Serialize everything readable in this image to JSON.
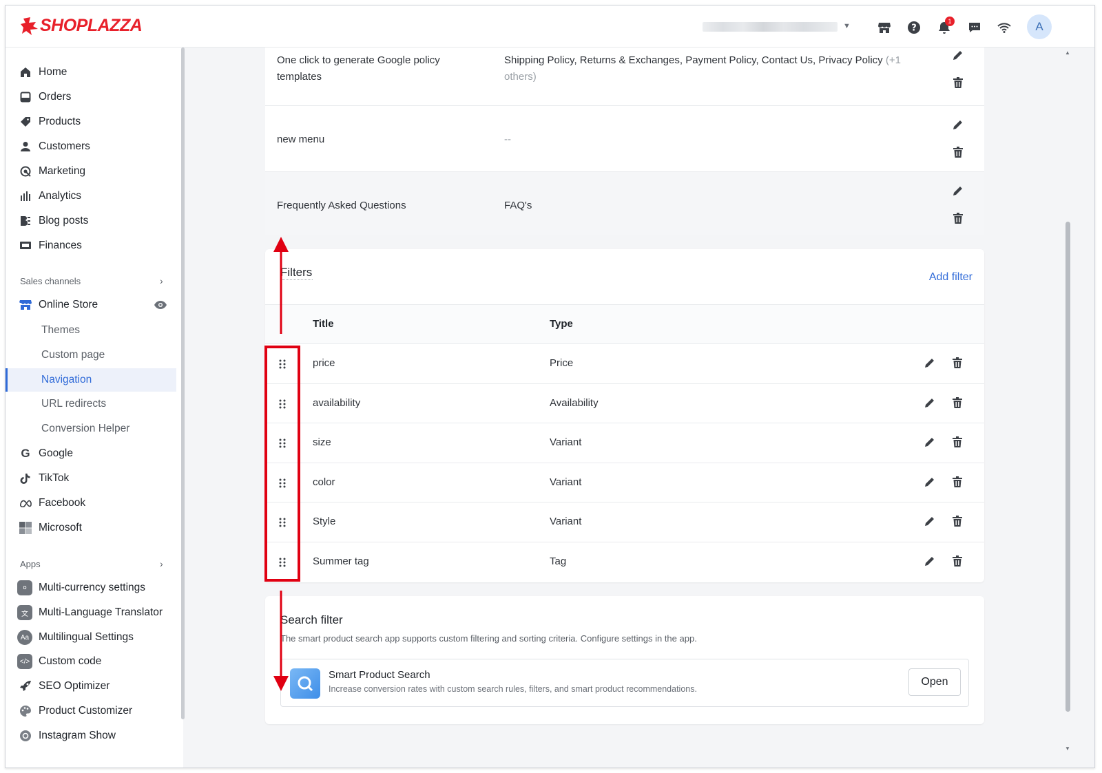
{
  "header": {
    "logo_text": "SHOPLAZZA",
    "notification_count": "1",
    "avatar_initial": "A"
  },
  "sidebar": {
    "main_items": [
      {
        "label": "Home",
        "icon": "home-icon"
      },
      {
        "label": "Orders",
        "icon": "orders-icon"
      },
      {
        "label": "Products",
        "icon": "tag-icon"
      },
      {
        "label": "Customers",
        "icon": "person-icon"
      },
      {
        "label": "Marketing",
        "icon": "marketing-icon"
      },
      {
        "label": "Analytics",
        "icon": "bar-chart-icon"
      },
      {
        "label": "Blog posts",
        "icon": "blog-icon"
      },
      {
        "label": "Finances",
        "icon": "finances-icon"
      }
    ],
    "sales_channels_label": "Sales channels",
    "online_store_label": "Online Store",
    "online_store_subitems": [
      "Themes",
      "Custom page",
      "Navigation",
      "URL redirects",
      "Conversion Helper"
    ],
    "active_subitem": "Navigation",
    "channels": [
      {
        "label": "Google",
        "icon": "google-icon"
      },
      {
        "label": "TikTok",
        "icon": "tiktok-icon"
      },
      {
        "label": "Facebook",
        "icon": "meta-icon"
      },
      {
        "label": "Microsoft",
        "icon": "microsoft-icon"
      }
    ],
    "apps_label": "Apps",
    "apps": [
      {
        "label": "Multi-currency settings",
        "icon": "currency-app-icon"
      },
      {
        "label": "Multi-Language Translator",
        "icon": "translator-app-icon"
      },
      {
        "label": "Multilingual Settings",
        "icon": "multilingual-app-icon"
      },
      {
        "label": "Custom code",
        "icon": "code-app-icon"
      },
      {
        "label": "SEO Optimizer",
        "icon": "rocket-app-icon"
      },
      {
        "label": "Product Customizer",
        "icon": "customizer-app-icon"
      },
      {
        "label": "Instagram Show",
        "icon": "instagram-app-icon"
      }
    ]
  },
  "menus": [
    {
      "title_line1": "One click to generate Google policy",
      "title_line2": "templates",
      "items_line1": "Shipping Policy, Returns & Exchanges, Payment Policy, Contact Us, Privacy Policy",
      "items_more_1": "(+1",
      "items_more_2": "others)"
    },
    {
      "title": "new menu",
      "items": "--"
    },
    {
      "title": "Frequently Asked Questions",
      "items": "FAQ's"
    }
  ],
  "filters": {
    "title": "Filters",
    "add_label": "Add filter",
    "col_title": "Title",
    "col_type": "Type",
    "rows": [
      {
        "title": "price",
        "type": "Price"
      },
      {
        "title": "availability",
        "type": "Availability"
      },
      {
        "title": "size",
        "type": "Variant"
      },
      {
        "title": "color",
        "type": "Variant"
      },
      {
        "title": "Style",
        "type": "Variant"
      },
      {
        "title": "Summer tag",
        "type": "Tag"
      }
    ]
  },
  "search_filter": {
    "title": "Search filter",
    "description": "The smart product search app supports custom filtering and sorting criteria. Configure settings in the app.",
    "app_name": "Smart Product Search",
    "app_description": "Increase conversion rates with custom search rules, filters, and smart product recommendations.",
    "open_label": "Open"
  },
  "colors": {
    "accent": "#2f6ad8",
    "annotation_red": "#e00012",
    "brand_red": "#e8202a"
  }
}
